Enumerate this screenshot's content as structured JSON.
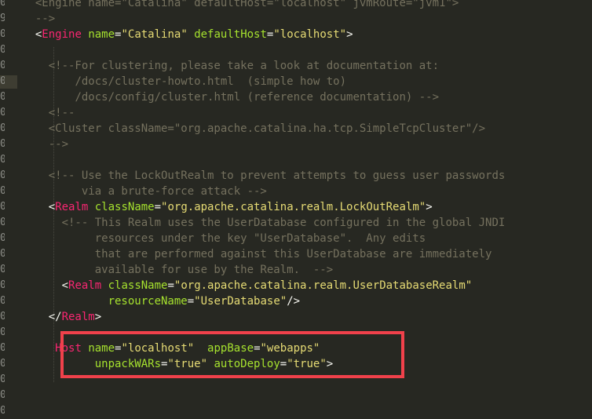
{
  "editor": {
    "gutter_numbers": [
      "0",
      "9",
      "0",
      "0",
      "0",
      "0",
      "0",
      "0",
      "0",
      "0",
      "0",
      "0",
      "0",
      "0",
      "0",
      "0",
      "0",
      "0",
      "0",
      "0",
      "0",
      "0",
      "0",
      "0",
      "0",
      "0",
      "0"
    ],
    "lines": [
      {
        "indent": "  ",
        "parts": [
          [
            "cm",
            "<Engine name=\"Catalina\" defaultHost=\"localhost\" jvmRoute=\"jvm1\">"
          ]
        ]
      },
      {
        "indent": "  ",
        "parts": [
          [
            "cm",
            "-->"
          ]
        ]
      },
      {
        "indent": "  ",
        "parts": [
          [
            "pl",
            "<"
          ],
          [
            "tag",
            "Engine"
          ],
          [
            "pl",
            " "
          ],
          [
            "attr",
            "name"
          ],
          [
            "pl",
            "="
          ],
          [
            "str",
            "\"Catalina\""
          ],
          [
            "pl",
            " "
          ],
          [
            "attr",
            "defaultHost"
          ],
          [
            "pl",
            "="
          ],
          [
            "str",
            "\"localhost\""
          ],
          [
            "pl",
            ">"
          ]
        ]
      },
      {
        "indent": "",
        "parts": []
      },
      {
        "indent": "    ",
        "parts": [
          [
            "cm",
            "<!--For clustering, please take a look at documentation at:"
          ]
        ]
      },
      {
        "indent": "        ",
        "parts": [
          [
            "cm",
            "/docs/cluster-howto.html  (simple how to)"
          ]
        ]
      },
      {
        "indent": "        ",
        "parts": [
          [
            "cm",
            "/docs/config/cluster.html (reference documentation) -->"
          ]
        ]
      },
      {
        "indent": "    ",
        "parts": [
          [
            "cm",
            "<!--"
          ]
        ]
      },
      {
        "indent": "    ",
        "parts": [
          [
            "cm",
            "<Cluster className=\"org.apache.catalina.ha.tcp.SimpleTcpCluster\"/>"
          ]
        ]
      },
      {
        "indent": "    ",
        "parts": [
          [
            "cm",
            "-->"
          ]
        ]
      },
      {
        "indent": "",
        "parts": []
      },
      {
        "indent": "    ",
        "parts": [
          [
            "cm",
            "<!-- Use the LockOutRealm to prevent attempts to guess user passwords"
          ]
        ]
      },
      {
        "indent": "         ",
        "parts": [
          [
            "cm",
            "via a brute-force attack -->"
          ]
        ]
      },
      {
        "indent": "    ",
        "parts": [
          [
            "pl",
            "<"
          ],
          [
            "tag",
            "Realm"
          ],
          [
            "pl",
            " "
          ],
          [
            "attr",
            "className"
          ],
          [
            "pl",
            "="
          ],
          [
            "str",
            "\"org.apache.catalina.realm.LockOutRealm\""
          ],
          [
            "pl",
            ">"
          ]
        ]
      },
      {
        "indent": "      ",
        "parts": [
          [
            "cm",
            "<!-- This Realm uses the UserDatabase configured in the global JNDI"
          ]
        ]
      },
      {
        "indent": "           ",
        "parts": [
          [
            "cm",
            "resources under the key \"UserDatabase\".  Any edits"
          ]
        ]
      },
      {
        "indent": "           ",
        "parts": [
          [
            "cm",
            "that are performed against this UserDatabase are immediately"
          ]
        ]
      },
      {
        "indent": "           ",
        "parts": [
          [
            "cm",
            "available for use by the Realm.  -->"
          ]
        ]
      },
      {
        "indent": "      ",
        "parts": [
          [
            "pl",
            "<"
          ],
          [
            "tag",
            "Realm"
          ],
          [
            "pl",
            " "
          ],
          [
            "attr",
            "className"
          ],
          [
            "pl",
            "="
          ],
          [
            "str",
            "\"org.apache.catalina.realm.UserDatabaseRealm\""
          ]
        ]
      },
      {
        "indent": "             ",
        "parts": [
          [
            "attr",
            "resourceName"
          ],
          [
            "pl",
            "="
          ],
          [
            "str",
            "\"UserDatabase\""
          ],
          [
            "pl",
            "/>"
          ]
        ]
      },
      {
        "indent": "    ",
        "parts": [
          [
            "pl",
            "</"
          ],
          [
            "tag",
            "Realm"
          ],
          [
            "pl",
            ">"
          ]
        ]
      },
      {
        "indent": "",
        "parts": []
      },
      {
        "indent": "     ",
        "parts": [
          [
            "tag",
            "Host"
          ],
          [
            "pl",
            " "
          ],
          [
            "attr",
            "name"
          ],
          [
            "pl",
            "="
          ],
          [
            "str",
            "\"localhost\""
          ],
          [
            "pl",
            "  "
          ],
          [
            "attr",
            "appBase"
          ],
          [
            "pl",
            "="
          ],
          [
            "str",
            "\"webapps\""
          ]
        ]
      },
      {
        "indent": "           ",
        "parts": [
          [
            "attr",
            "unpackWARs"
          ],
          [
            "pl",
            "="
          ],
          [
            "str",
            "\"true\""
          ],
          [
            "pl",
            " "
          ],
          [
            "attr",
            "autoDeploy"
          ],
          [
            "pl",
            "="
          ],
          [
            "str",
            "\"true\""
          ],
          [
            "pl",
            ">"
          ]
        ]
      },
      {
        "indent": "",
        "parts": []
      }
    ]
  },
  "colors": {
    "background": "#272822",
    "tag": "#f92672",
    "attribute": "#a6e22e",
    "string": "#e6db74",
    "comment": "#75715e",
    "highlight_box": "#f0414b"
  }
}
